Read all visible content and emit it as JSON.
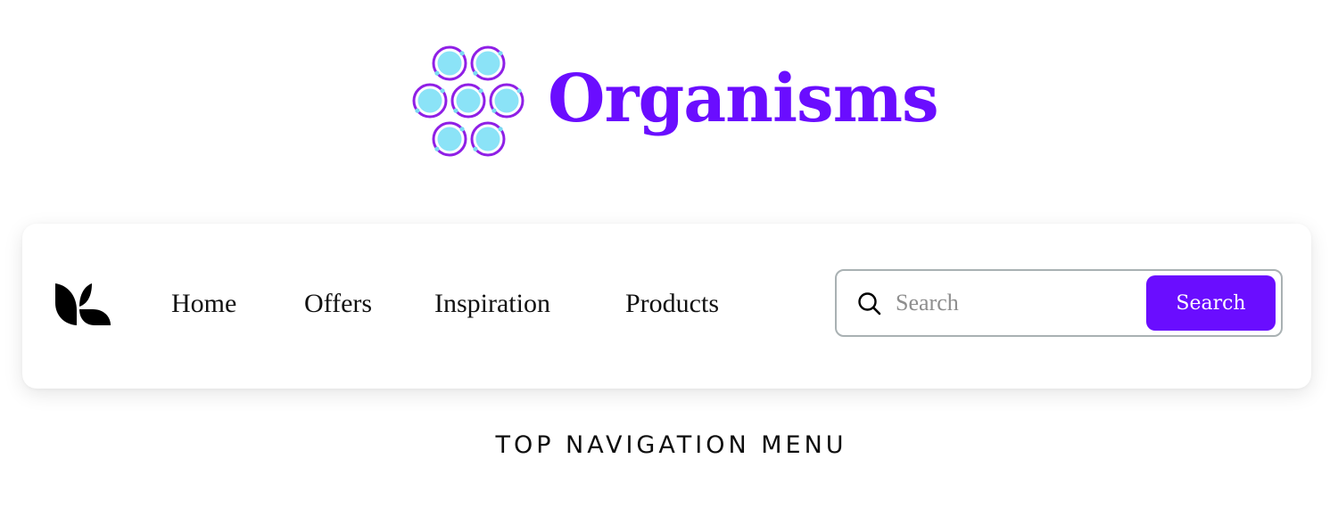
{
  "header": {
    "title": "Organisms",
    "icon": "molecule-cluster-icon",
    "colors": {
      "title": "#6a0dff",
      "ring": "#8f1fe6",
      "disc": "#8be3f7",
      "dot": "#7ad9f2"
    }
  },
  "navbar": {
    "logo": "leaf-logo-icon",
    "items": [
      {
        "label": "Home"
      },
      {
        "label": "Offers"
      },
      {
        "label": "Inspiration"
      },
      {
        "label": "Products"
      }
    ],
    "search": {
      "icon": "search-icon",
      "placeholder": "Search",
      "value": "",
      "button_label": "Search",
      "button_color": "#6a0dff",
      "border_color": "#a9b1b3"
    }
  },
  "caption": "TOP NAVIGATION MENU"
}
